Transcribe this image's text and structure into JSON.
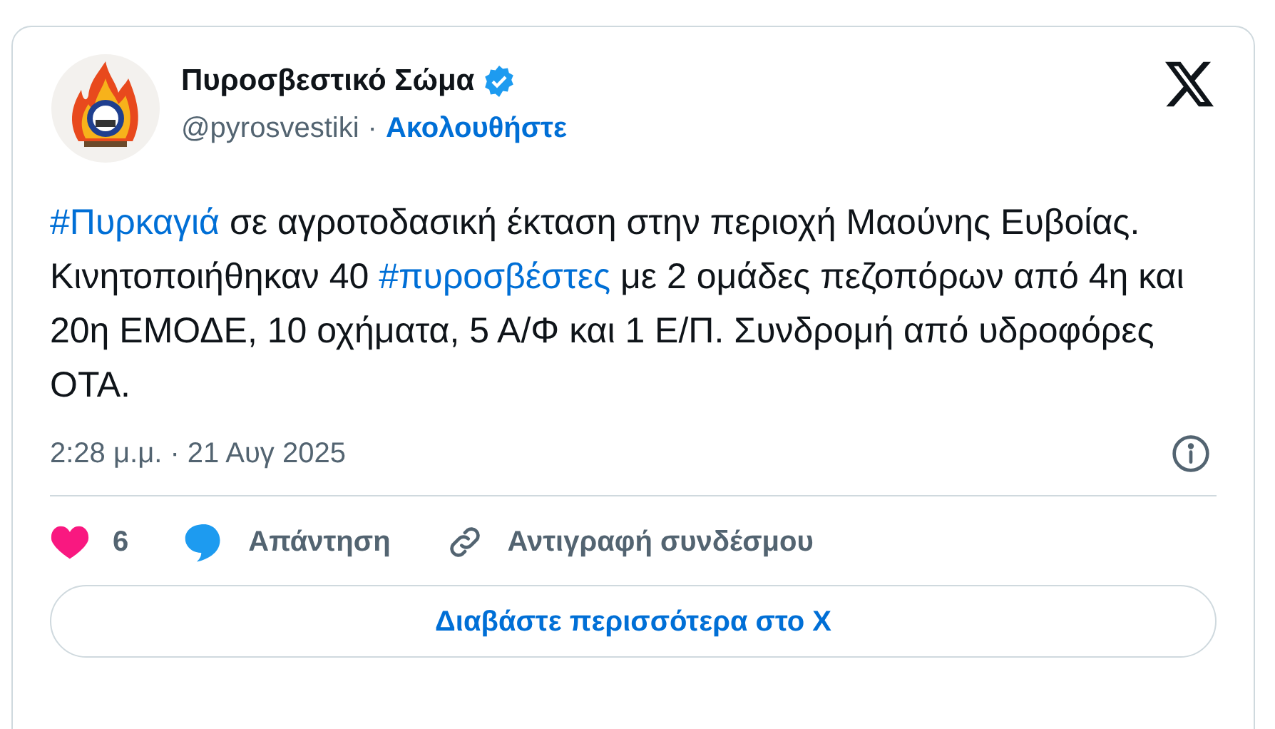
{
  "author": {
    "name": "Πυροσβεστικό Σώμα",
    "verified": true,
    "handle": "@pyrosvestiki",
    "separator": "·",
    "follow": "Ακολουθήστε"
  },
  "body": [
    {
      "kind": "hashtag",
      "text": "#Πυρκαγιά"
    },
    {
      "kind": "text",
      "text": " σε αγροτοδασική έκταση στην περιοχή Μαούνης Ευβοίας. Κινητοποιήθηκαν 40 "
    },
    {
      "kind": "hashtag",
      "text": "#πυροσβέστες"
    },
    {
      "kind": "text",
      "text": " με 2 ομάδες πεζοπόρων από 4η και 20η ΕΜΟΔΕ, 10 οχήματα, 5 Α/Φ και 1 Ε/Π. Συνδρομή από υδροφόρες ΟΤΑ."
    }
  ],
  "timestamp": "2:28 μ.μ. · 21 Αυγ 2025",
  "actions": [
    {
      "kind": "like",
      "label": "6"
    },
    {
      "kind": "reply",
      "label": "Απάντηση"
    },
    {
      "kind": "copy",
      "label": "Αντιγραφή συνδέσμου"
    }
  ],
  "read_more": "Διαβάστε περισσότερα στο X"
}
